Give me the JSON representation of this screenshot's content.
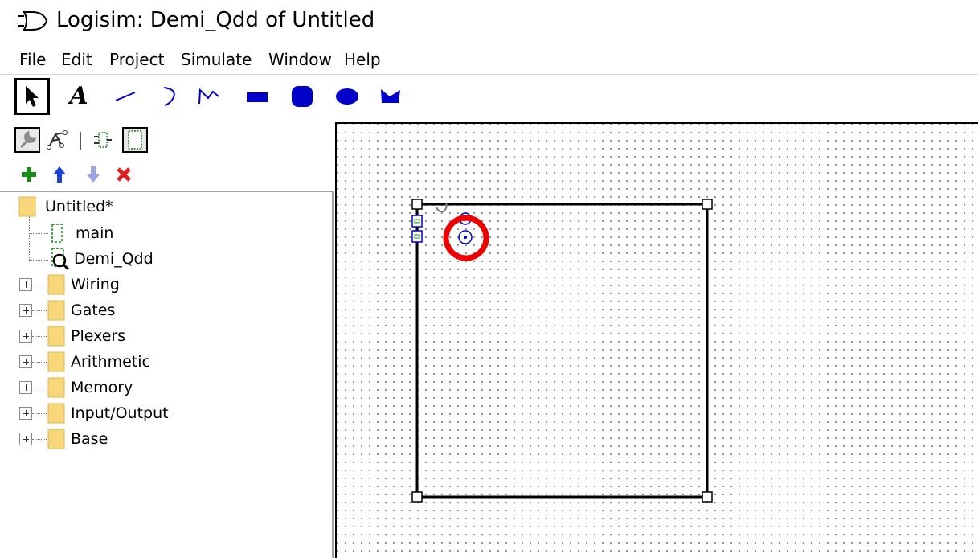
{
  "window": {
    "title": "Logisim: Demi_Qdd of Untitled"
  },
  "menu": {
    "items": [
      "File",
      "Edit",
      "Project",
      "Simulate",
      "Window",
      "Help"
    ]
  },
  "toolbar": {
    "text_tool_glyph": "A",
    "tools": [
      "select-tool",
      "text-tool",
      "line-tool",
      "curve-tool",
      "polyline-tool",
      "rectangle-tool",
      "rounded-rectangle-tool",
      "oval-tool",
      "polygon-tool"
    ]
  },
  "explorer": {
    "items": [
      {
        "label": "Untitled*"
      },
      {
        "label": "main"
      },
      {
        "label": "Demi_Qdd"
      },
      {
        "label": "Wiring"
      },
      {
        "label": "Gates"
      },
      {
        "label": "Plexers"
      },
      {
        "label": "Arithmetic"
      },
      {
        "label": "Memory"
      },
      {
        "label": "Input/Output"
      },
      {
        "label": "Base"
      }
    ]
  },
  "colors": {
    "shape_blue": "#0000c8",
    "add_green": "#1a8a1a",
    "delete_red": "#e02020",
    "arrow_blue": "#1c3fd6",
    "arrow_disabled": "#9aa6e6",
    "highlight_red": "#ee0000",
    "folder_yellow": "#f7d77a"
  }
}
